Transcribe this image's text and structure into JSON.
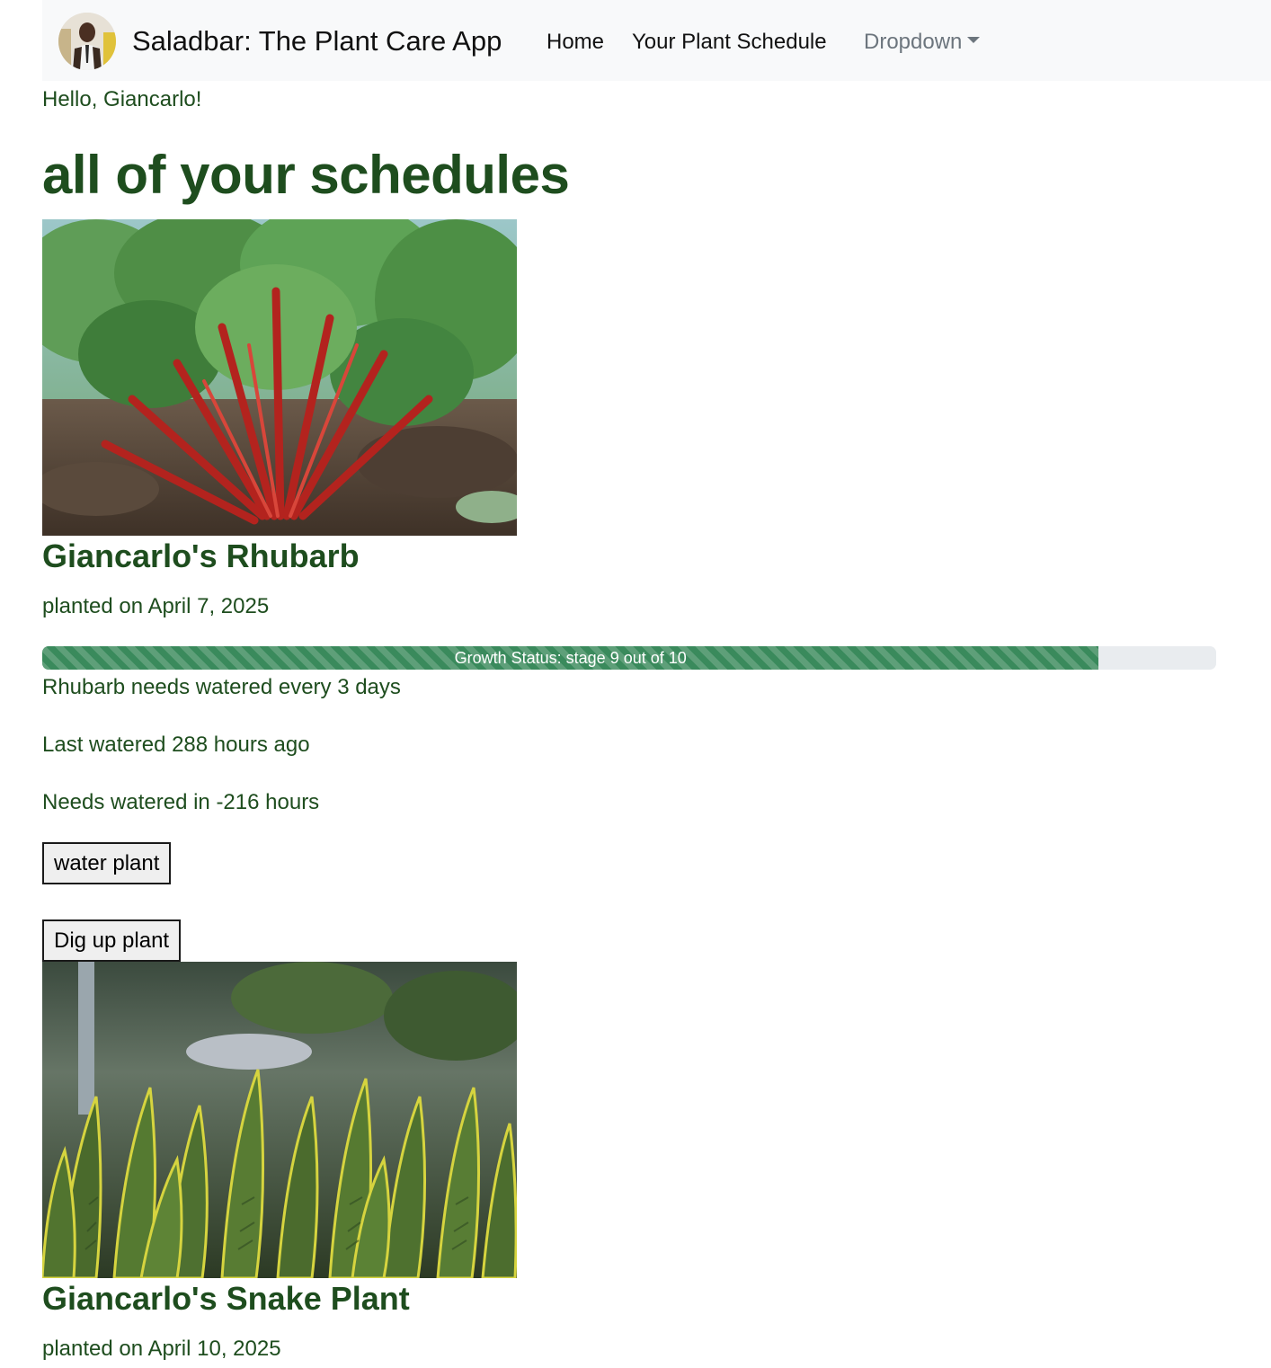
{
  "navbar": {
    "brand": "Saladbar: The Plant Care App",
    "avatar_icon": "user-avatar",
    "links": [
      {
        "label": "Home"
      },
      {
        "label": "Your Plant Schedule"
      },
      {
        "label": "Dropdown"
      }
    ]
  },
  "greeting": "Hello, Giancarlo!",
  "page_title": "all of your schedules",
  "colors": {
    "text_green": "#1e4d1e",
    "progress_green": "#3a8a5c",
    "navbar_bg": "#f8f9fa"
  },
  "schedules": [
    {
      "name": "Giancarlo's Rhubarb",
      "image": "rhubarb-photo",
      "planted": "planted on April 7, 2025",
      "progress": {
        "label": "Growth Status: stage 9 out of 10",
        "stage": 9,
        "total": 10
      },
      "water_every": "Rhubarb needs watered every 3 days",
      "last_watered": "Last watered 288 hours ago",
      "needs_watered": "Needs watered in -216 hours",
      "water_button": "water plant",
      "dig_button": "Dig up plant"
    },
    {
      "name": "Giancarlo's Snake Plant",
      "image": "snake-plant-photo",
      "planted": "planted on April 10, 2025"
    }
  ]
}
